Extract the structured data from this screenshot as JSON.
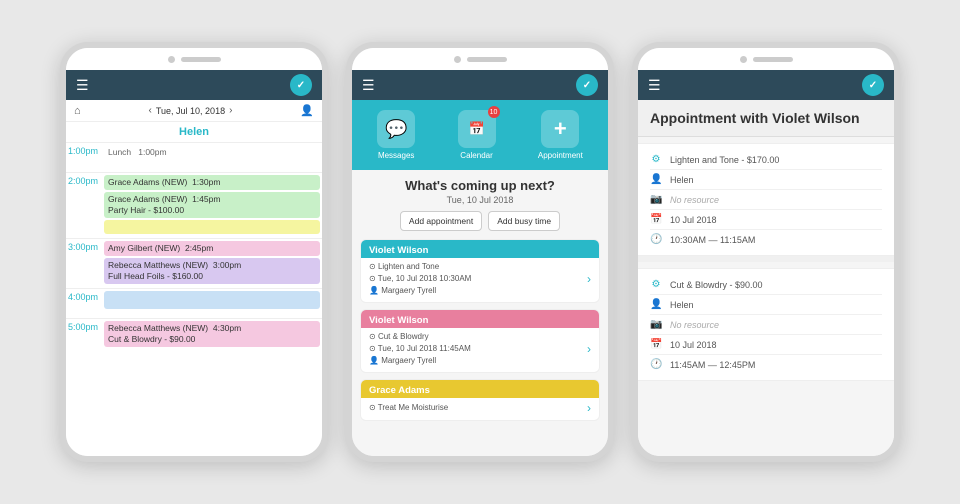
{
  "colors": {
    "header_bg": "#2d4a5a",
    "accent": "#29b8c8",
    "white": "#ffffff"
  },
  "phone1": {
    "header": {
      "hamburger": "☰",
      "logo": "✓"
    },
    "nav": {
      "home_icon": "⌂",
      "prev": "‹",
      "date": "Tue, Jul 10, 2018",
      "next": "›",
      "profile": "👤"
    },
    "staff_name": "Helen",
    "events": [
      {
        "time": "1:00pm",
        "entries": [
          {
            "type": "lunch",
            "text": "Lunch  1:00pm"
          }
        ]
      },
      {
        "time": "2:00pm",
        "entries": [
          {
            "type": "green",
            "text": "Grace Adams (NEW)  1:30pm"
          },
          {
            "type": "green",
            "text": "Grace Adams (NEW)  1:45pm\nParty Hair - $100.00"
          },
          {
            "type": "yellow",
            "text": ""
          }
        ]
      },
      {
        "time": "3:00pm",
        "entries": [
          {
            "type": "pink",
            "text": "Amy Gilbert (NEW)  2:45pm"
          },
          {
            "type": "purple",
            "text": "Rebecca Matthews (NEW)  3:00pm\nFull Head Foils - $160.00"
          }
        ]
      },
      {
        "time": "4:00pm",
        "entries": [
          {
            "type": "blue-light",
            "text": ""
          }
        ]
      },
      {
        "time": "5:00pm",
        "entries": [
          {
            "type": "pink",
            "text": "Rebecca Matthews (NEW)  4:30pm\nCut & Blowdry - $90.00"
          }
        ]
      }
    ]
  },
  "phone2": {
    "header": {
      "hamburger": "☰",
      "logo": "✓"
    },
    "icons": [
      {
        "symbol": "💬",
        "label": "Messages"
      },
      {
        "symbol": "📅",
        "label": "Calendar",
        "badge": "10"
      },
      {
        "symbol": "+",
        "label": "Appointment"
      }
    ],
    "whats_next": "What's coming up next?",
    "date": "Tue, 10 Jul 2018",
    "add_appointment": "Add appointment",
    "add_busy_time": "Add busy time",
    "appointments": [
      {
        "color": "teal",
        "name": "Violet Wilson",
        "service": "Lighten and Tone",
        "date_time": "Tue, 10 Jul 2018  10:30AM",
        "staff": "Margaery Tyrell"
      },
      {
        "color": "pink",
        "name": "Violet Wilson",
        "service": "Cut & Blowdry",
        "date_time": "Tue, 10 Jul 2018  11:45AM",
        "staff": "Margaery Tyrell"
      },
      {
        "color": "yellow",
        "name": "Grace Adams",
        "service": "Treat Me Moisturise",
        "date_time": "",
        "staff": ""
      }
    ]
  },
  "phone3": {
    "header": {
      "hamburger": "☰",
      "logo": "✓"
    },
    "title": "Appointment with Violet Wilson",
    "details_section1": [
      {
        "icon": "⚙",
        "text": "Lighten and Tone - $170.00"
      },
      {
        "icon": "👤",
        "text": "Helen"
      },
      {
        "icon": "📷",
        "text": "No resource"
      },
      {
        "icon": "📅",
        "text": "10 Jul 2018"
      },
      {
        "icon": "🕐",
        "text": "10:30AM — 11:15AM"
      }
    ],
    "details_section2": [
      {
        "icon": "⚙",
        "text": "Cut & Blowdry - $90.00"
      },
      {
        "icon": "👤",
        "text": "Helen"
      },
      {
        "icon": "📷",
        "text": "No resource"
      },
      {
        "icon": "📅",
        "text": "10 Jul 2018"
      },
      {
        "icon": "🕐",
        "text": "11:45AM — 12:45PM"
      }
    ]
  }
}
